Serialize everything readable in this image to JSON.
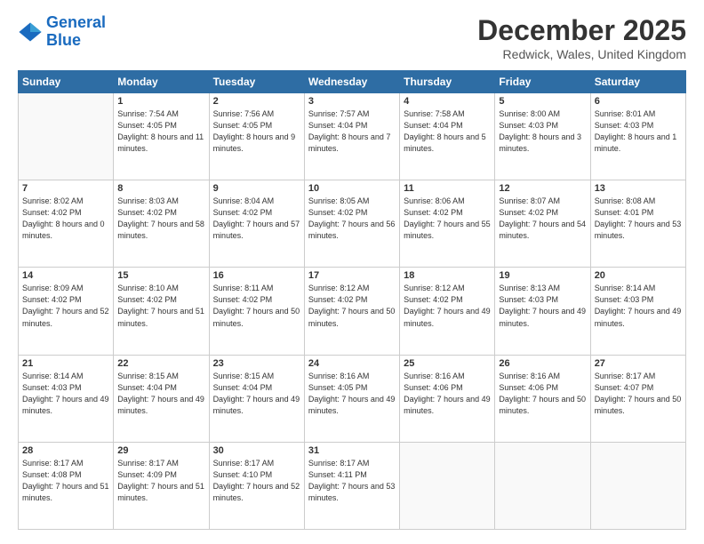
{
  "logo": {
    "line1": "General",
    "line2": "Blue"
  },
  "title": "December 2025",
  "subtitle": "Redwick, Wales, United Kingdom",
  "days": [
    "Sunday",
    "Monday",
    "Tuesday",
    "Wednesday",
    "Thursday",
    "Friday",
    "Saturday"
  ],
  "weeks": [
    [
      {
        "num": "",
        "sunrise": "",
        "sunset": "",
        "daylight": ""
      },
      {
        "num": "1",
        "sunrise": "Sunrise: 7:54 AM",
        "sunset": "Sunset: 4:05 PM",
        "daylight": "Daylight: 8 hours and 11 minutes."
      },
      {
        "num": "2",
        "sunrise": "Sunrise: 7:56 AM",
        "sunset": "Sunset: 4:05 PM",
        "daylight": "Daylight: 8 hours and 9 minutes."
      },
      {
        "num": "3",
        "sunrise": "Sunrise: 7:57 AM",
        "sunset": "Sunset: 4:04 PM",
        "daylight": "Daylight: 8 hours and 7 minutes."
      },
      {
        "num": "4",
        "sunrise": "Sunrise: 7:58 AM",
        "sunset": "Sunset: 4:04 PM",
        "daylight": "Daylight: 8 hours and 5 minutes."
      },
      {
        "num": "5",
        "sunrise": "Sunrise: 8:00 AM",
        "sunset": "Sunset: 4:03 PM",
        "daylight": "Daylight: 8 hours and 3 minutes."
      },
      {
        "num": "6",
        "sunrise": "Sunrise: 8:01 AM",
        "sunset": "Sunset: 4:03 PM",
        "daylight": "Daylight: 8 hours and 1 minute."
      }
    ],
    [
      {
        "num": "7",
        "sunrise": "Sunrise: 8:02 AM",
        "sunset": "Sunset: 4:02 PM",
        "daylight": "Daylight: 8 hours and 0 minutes."
      },
      {
        "num": "8",
        "sunrise": "Sunrise: 8:03 AM",
        "sunset": "Sunset: 4:02 PM",
        "daylight": "Daylight: 7 hours and 58 minutes."
      },
      {
        "num": "9",
        "sunrise": "Sunrise: 8:04 AM",
        "sunset": "Sunset: 4:02 PM",
        "daylight": "Daylight: 7 hours and 57 minutes."
      },
      {
        "num": "10",
        "sunrise": "Sunrise: 8:05 AM",
        "sunset": "Sunset: 4:02 PM",
        "daylight": "Daylight: 7 hours and 56 minutes."
      },
      {
        "num": "11",
        "sunrise": "Sunrise: 8:06 AM",
        "sunset": "Sunset: 4:02 PM",
        "daylight": "Daylight: 7 hours and 55 minutes."
      },
      {
        "num": "12",
        "sunrise": "Sunrise: 8:07 AM",
        "sunset": "Sunset: 4:02 PM",
        "daylight": "Daylight: 7 hours and 54 minutes."
      },
      {
        "num": "13",
        "sunrise": "Sunrise: 8:08 AM",
        "sunset": "Sunset: 4:01 PM",
        "daylight": "Daylight: 7 hours and 53 minutes."
      }
    ],
    [
      {
        "num": "14",
        "sunrise": "Sunrise: 8:09 AM",
        "sunset": "Sunset: 4:02 PM",
        "daylight": "Daylight: 7 hours and 52 minutes."
      },
      {
        "num": "15",
        "sunrise": "Sunrise: 8:10 AM",
        "sunset": "Sunset: 4:02 PM",
        "daylight": "Daylight: 7 hours and 51 minutes."
      },
      {
        "num": "16",
        "sunrise": "Sunrise: 8:11 AM",
        "sunset": "Sunset: 4:02 PM",
        "daylight": "Daylight: 7 hours and 50 minutes."
      },
      {
        "num": "17",
        "sunrise": "Sunrise: 8:12 AM",
        "sunset": "Sunset: 4:02 PM",
        "daylight": "Daylight: 7 hours and 50 minutes."
      },
      {
        "num": "18",
        "sunrise": "Sunrise: 8:12 AM",
        "sunset": "Sunset: 4:02 PM",
        "daylight": "Daylight: 7 hours and 49 minutes."
      },
      {
        "num": "19",
        "sunrise": "Sunrise: 8:13 AM",
        "sunset": "Sunset: 4:03 PM",
        "daylight": "Daylight: 7 hours and 49 minutes."
      },
      {
        "num": "20",
        "sunrise": "Sunrise: 8:14 AM",
        "sunset": "Sunset: 4:03 PM",
        "daylight": "Daylight: 7 hours and 49 minutes."
      }
    ],
    [
      {
        "num": "21",
        "sunrise": "Sunrise: 8:14 AM",
        "sunset": "Sunset: 4:03 PM",
        "daylight": "Daylight: 7 hours and 49 minutes."
      },
      {
        "num": "22",
        "sunrise": "Sunrise: 8:15 AM",
        "sunset": "Sunset: 4:04 PM",
        "daylight": "Daylight: 7 hours and 49 minutes."
      },
      {
        "num": "23",
        "sunrise": "Sunrise: 8:15 AM",
        "sunset": "Sunset: 4:04 PM",
        "daylight": "Daylight: 7 hours and 49 minutes."
      },
      {
        "num": "24",
        "sunrise": "Sunrise: 8:16 AM",
        "sunset": "Sunset: 4:05 PM",
        "daylight": "Daylight: 7 hours and 49 minutes."
      },
      {
        "num": "25",
        "sunrise": "Sunrise: 8:16 AM",
        "sunset": "Sunset: 4:06 PM",
        "daylight": "Daylight: 7 hours and 49 minutes."
      },
      {
        "num": "26",
        "sunrise": "Sunrise: 8:16 AM",
        "sunset": "Sunset: 4:06 PM",
        "daylight": "Daylight: 7 hours and 50 minutes."
      },
      {
        "num": "27",
        "sunrise": "Sunrise: 8:17 AM",
        "sunset": "Sunset: 4:07 PM",
        "daylight": "Daylight: 7 hours and 50 minutes."
      }
    ],
    [
      {
        "num": "28",
        "sunrise": "Sunrise: 8:17 AM",
        "sunset": "Sunset: 4:08 PM",
        "daylight": "Daylight: 7 hours and 51 minutes."
      },
      {
        "num": "29",
        "sunrise": "Sunrise: 8:17 AM",
        "sunset": "Sunset: 4:09 PM",
        "daylight": "Daylight: 7 hours and 51 minutes."
      },
      {
        "num": "30",
        "sunrise": "Sunrise: 8:17 AM",
        "sunset": "Sunset: 4:10 PM",
        "daylight": "Daylight: 7 hours and 52 minutes."
      },
      {
        "num": "31",
        "sunrise": "Sunrise: 8:17 AM",
        "sunset": "Sunset: 4:11 PM",
        "daylight": "Daylight: 7 hours and 53 minutes."
      },
      {
        "num": "",
        "sunrise": "",
        "sunset": "",
        "daylight": ""
      },
      {
        "num": "",
        "sunrise": "",
        "sunset": "",
        "daylight": ""
      },
      {
        "num": "",
        "sunrise": "",
        "sunset": "",
        "daylight": ""
      }
    ]
  ]
}
